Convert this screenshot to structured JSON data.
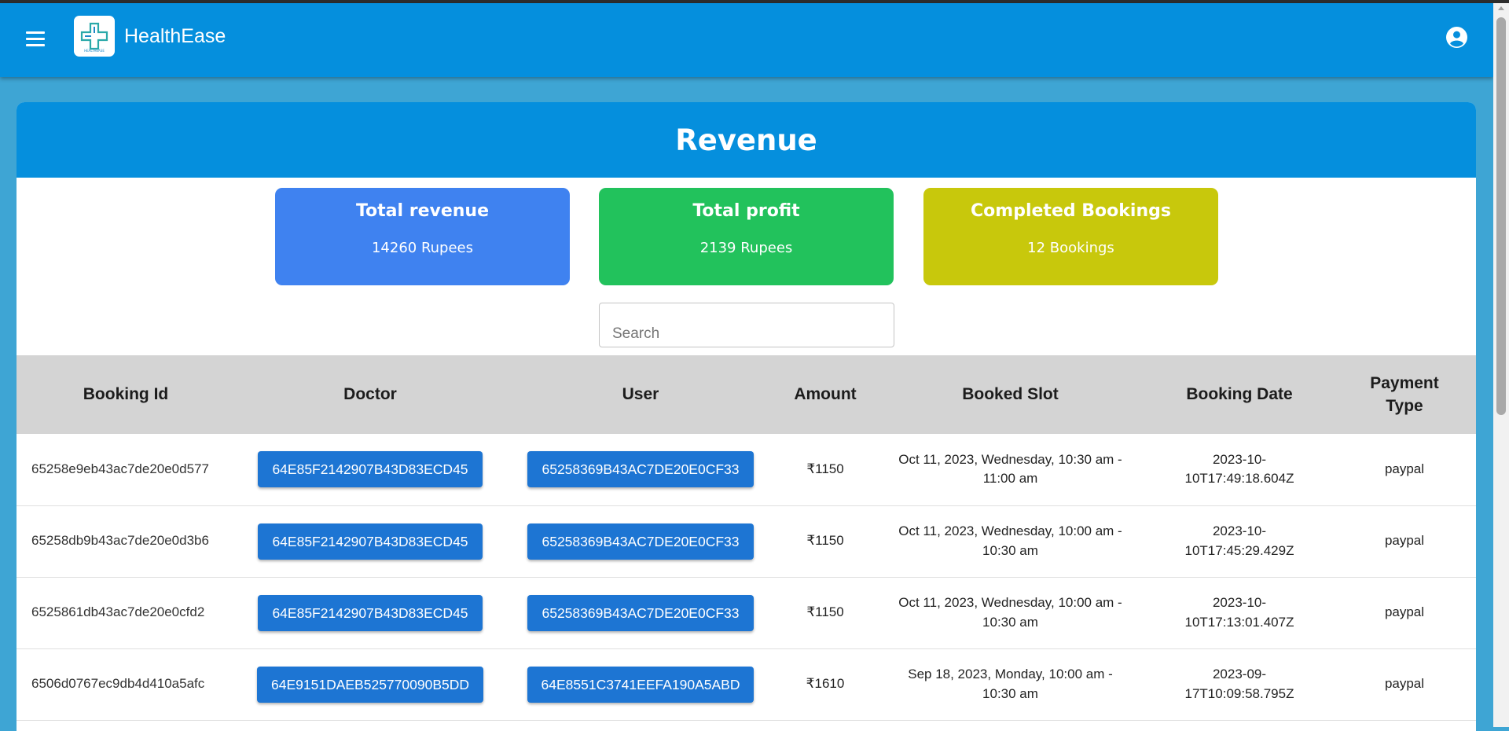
{
  "app": {
    "brand": "HealthEase",
    "logo_text": "HEALTHEASE"
  },
  "page": {
    "title": "Revenue"
  },
  "stats": [
    {
      "title": "Total revenue",
      "value": "14260 Rupees",
      "color": "#3f82f0"
    },
    {
      "title": "Total profit",
      "value": "2139 Rupees",
      "color": "#22c25c"
    },
    {
      "title": "Completed Bookings",
      "value": "12 Bookings",
      "color": "#c8c80c"
    }
  ],
  "search": {
    "placeholder": "Search"
  },
  "table": {
    "headers": {
      "booking_id": "Booking Id",
      "doctor": "Doctor",
      "user": "User",
      "amount": "Amount",
      "booked_slot": "Booked Slot",
      "booking_date": "Booking Date",
      "payment_type": "Payment Type"
    },
    "rows": [
      {
        "booking_id": "65258e9eb43ac7de20e0d577",
        "doctor": "64E85F2142907B43D83ECD45",
        "user": "65258369B43AC7DE20E0CF33",
        "amount": "₹1150",
        "slot_line1": "Oct 11, 2023, Wednesday, 10:30 am -",
        "slot_line2": "11:00 am",
        "date_line1": "2023-10-",
        "date_line2": "10T17:49:18.604Z",
        "payment": "paypal"
      },
      {
        "booking_id": "65258db9b43ac7de20e0d3b6",
        "doctor": "64E85F2142907B43D83ECD45",
        "user": "65258369B43AC7DE20E0CF33",
        "amount": "₹1150",
        "slot_line1": "Oct 11, 2023, Wednesday, 10:00 am -",
        "slot_line2": "10:30 am",
        "date_line1": "2023-10-",
        "date_line2": "10T17:45:29.429Z",
        "payment": "paypal"
      },
      {
        "booking_id": "6525861db43ac7de20e0cfd2",
        "doctor": "64E85F2142907B43D83ECD45",
        "user": "65258369B43AC7DE20E0CF33",
        "amount": "₹1150",
        "slot_line1": "Oct 11, 2023, Wednesday, 10:00 am -",
        "slot_line2": "10:30 am",
        "date_line1": "2023-10-",
        "date_line2": "10T17:13:01.407Z",
        "payment": "paypal"
      },
      {
        "booking_id": "6506d0767ec9db4d410a5afc",
        "doctor": "64E9151DAEB525770090B5DD",
        "user": "64E8551C3741EEFA190A5ABD",
        "amount": "₹1610",
        "slot_line1": "Sep 18, 2023, Monday, 10:00 am -",
        "slot_line2": "10:30 am",
        "date_line1": "2023-09-",
        "date_line2": "17T10:09:58.795Z",
        "payment": "paypal"
      }
    ]
  },
  "icons": {
    "menu": "menu-icon",
    "account": "account-circle-icon",
    "logo": "medical-cross-logo-icon"
  }
}
